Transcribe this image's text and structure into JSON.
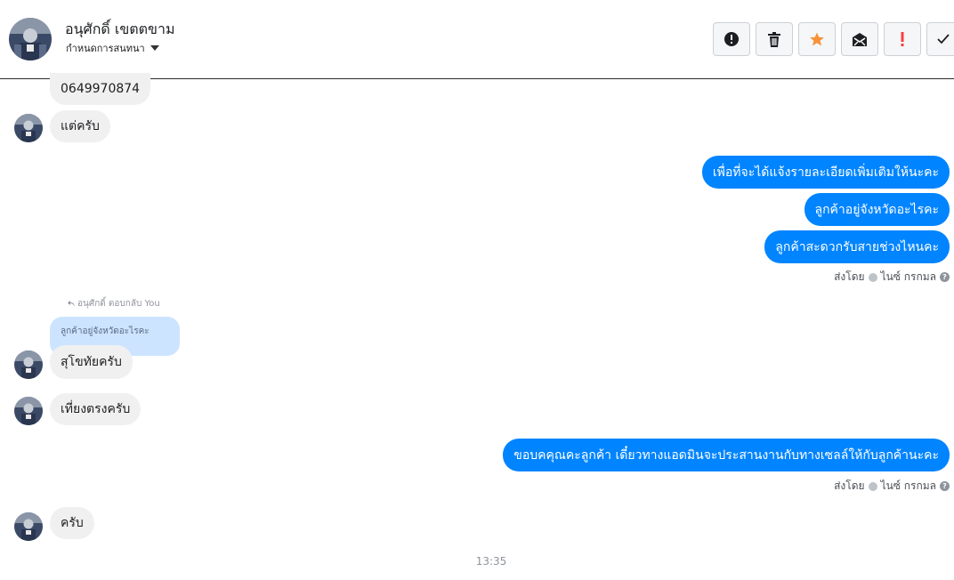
{
  "header": {
    "contact_name": "อนุศักดิ์ เขตตขาม",
    "subtitle": "กำหนดการสนทนา",
    "toolbar": [
      {
        "name": "report-spam",
        "icon": "alert-circle-icon"
      },
      {
        "name": "delete",
        "icon": "trash-icon"
      },
      {
        "name": "star",
        "icon": "star-icon",
        "color": "#f7923b"
      },
      {
        "name": "mark-unread",
        "icon": "envelope-icon"
      },
      {
        "name": "important",
        "icon": "exclamation-icon",
        "color": "#fa3e3e"
      },
      {
        "name": "mark-done",
        "icon": "check-icon"
      }
    ]
  },
  "messages": {
    "m1": "0649970874",
    "m2": "แต่ครับ",
    "m3": "เพื่อที่จะได้แจ้งรายละเอียดเพิ่มเติมให้นะคะ",
    "m4": "ลูกค้าอยู่จังหวัดอะไรคะ",
    "m5": "ลูกค้าสะดวกรับสายช่วงไหนคะ",
    "sent_by_1": "ส่งโดย",
    "sent_by_name_1": "ไนซ์ กรกมล",
    "reply_label": "อนุศักดิ์ ตอบกลับ You",
    "quoted_text": "ลูกค้าอยู่จังหวัดอะไรคะ",
    "m6": "สุโขทัยครับ",
    "m7": "เที่ยงตรงครับ",
    "m8": "ขอบคคุณคะลูกค้า เดี๋ยวทางแอดมินจะประสานงานกับทางเซลล์ให้กับลูกค้านะคะ",
    "sent_by_2": "ส่งโดย",
    "sent_by_name_2": "ไนซ์ กรกมล",
    "m9": "ครับ",
    "timestamp": "13:35"
  },
  "colors": {
    "outgoing_bubble": "#0084ff",
    "incoming_bubble": "#f1f0f0",
    "quoted_bubble": "#cce4ff",
    "star": "#f7923b",
    "important": "#fa3e3e"
  }
}
